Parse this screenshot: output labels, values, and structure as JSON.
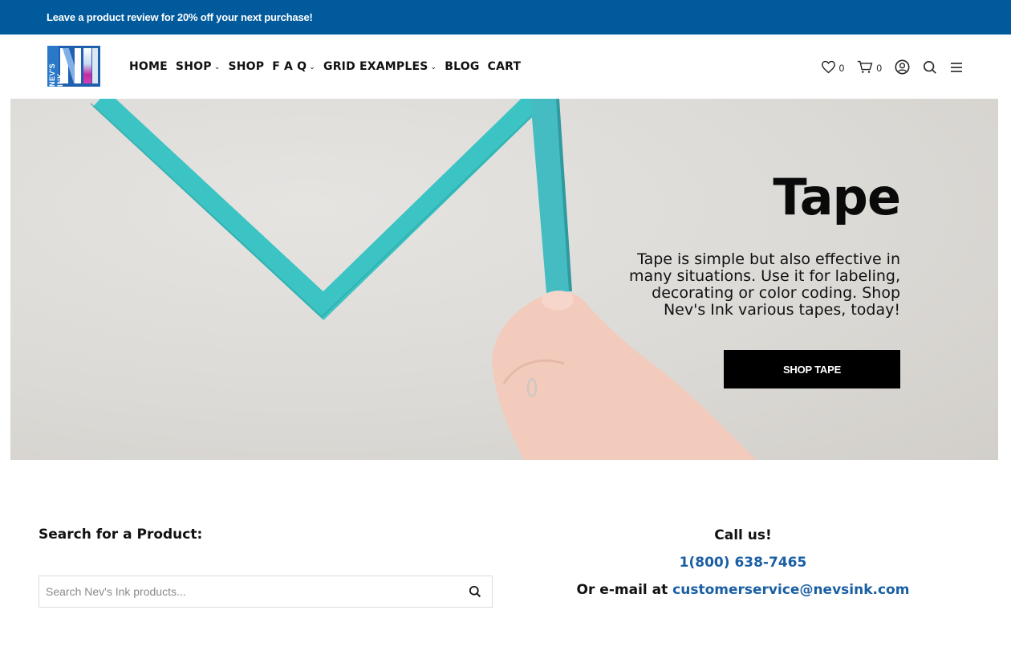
{
  "promo": {
    "text": "Leave a product review for 20% off your next purchase!"
  },
  "brand": {
    "logo_text": "NEV'S INK",
    "accent": "#005a9c"
  },
  "nav": [
    {
      "label": "HOME",
      "dropdown": false
    },
    {
      "label": "SHOP",
      "dropdown": true
    },
    {
      "label": "SHOP",
      "dropdown": false
    },
    {
      "label": "F A Q",
      "dropdown": true
    },
    {
      "label": "GRID EXAMPLES",
      "dropdown": true
    },
    {
      "label": "BLOG",
      "dropdown": false
    },
    {
      "label": "CART",
      "dropdown": false
    }
  ],
  "header_icons": {
    "wishlist_count": "0",
    "cart_count": "0",
    "icons": [
      "heart-icon",
      "cart-icon",
      "account-icon",
      "search-icon",
      "menu-icon"
    ]
  },
  "hero": {
    "title": "Tape",
    "description": "Tape is simple but also effective in many situations. Use it for labeling, decorating or color coding. Shop Nev's Ink various tapes, today!",
    "button_label": "SHOP TAPE",
    "tape_color": "#3cc4c4"
  },
  "search": {
    "label": "Search for a Product:",
    "placeholder": "Search Nev's Ink products..."
  },
  "contact": {
    "heading": "Call us!",
    "phone": "1(800) 638-7465",
    "email_prefix": "Or e-mail at",
    "email": "customerservice@nevsink.com",
    "link_color": "#1a5fa3"
  }
}
